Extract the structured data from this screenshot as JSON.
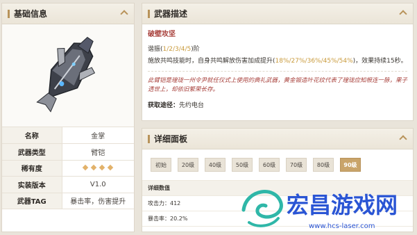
{
  "basic": {
    "title": "基础信息",
    "rows": [
      {
        "key": "名称",
        "value": "金掌"
      },
      {
        "key": "武器类型",
        "value": "臂铠"
      },
      {
        "key": "稀有度",
        "value": "",
        "stars": 4
      },
      {
        "key": "实装版本",
        "value": "V1.0"
      },
      {
        "key": "武器TAG",
        "value": "暴击率，伤害提升"
      }
    ]
  },
  "description": {
    "title": "武器描述",
    "skill_name": "破壁攻坚",
    "tuning_prefix": "谐振(",
    "tuning_values": "1/2/3/4/5",
    "tuning_suffix": ")阶",
    "effect_prefix": "施放共鸣技能时，自身共鸣解放伤害加成提升(",
    "effect_values": "18%/27%/36%/45%/54%",
    "effect_suffix": ")，效果持续15秒。",
    "lore": "此臂铠是瑝珑一州令尹就任仪式上使用的典礼武器，黄金锻造叶花纹代表了瑝珑应知根连一脉，果子透世上，却依旧繁荣长存。",
    "source_label": "获取途径：",
    "source_value": "先约电台"
  },
  "detail": {
    "title": "详细面板",
    "levels": [
      "初始",
      "20级",
      "40级",
      "50级",
      "60级",
      "70级",
      "80级",
      "90级"
    ],
    "active_level": "90级",
    "section_title": "详细数值",
    "stats": [
      {
        "label": "攻击力：",
        "value": "412"
      },
      {
        "label": "暴击率：",
        "value": "20.2%"
      }
    ]
  },
  "watermark": {
    "brand": "宏昌游戏网",
    "url": "www.hcs-laser.com"
  },
  "colors": {
    "accent": "#b8935a",
    "highlight": "#c99a3b",
    "red": "#a8413c"
  }
}
